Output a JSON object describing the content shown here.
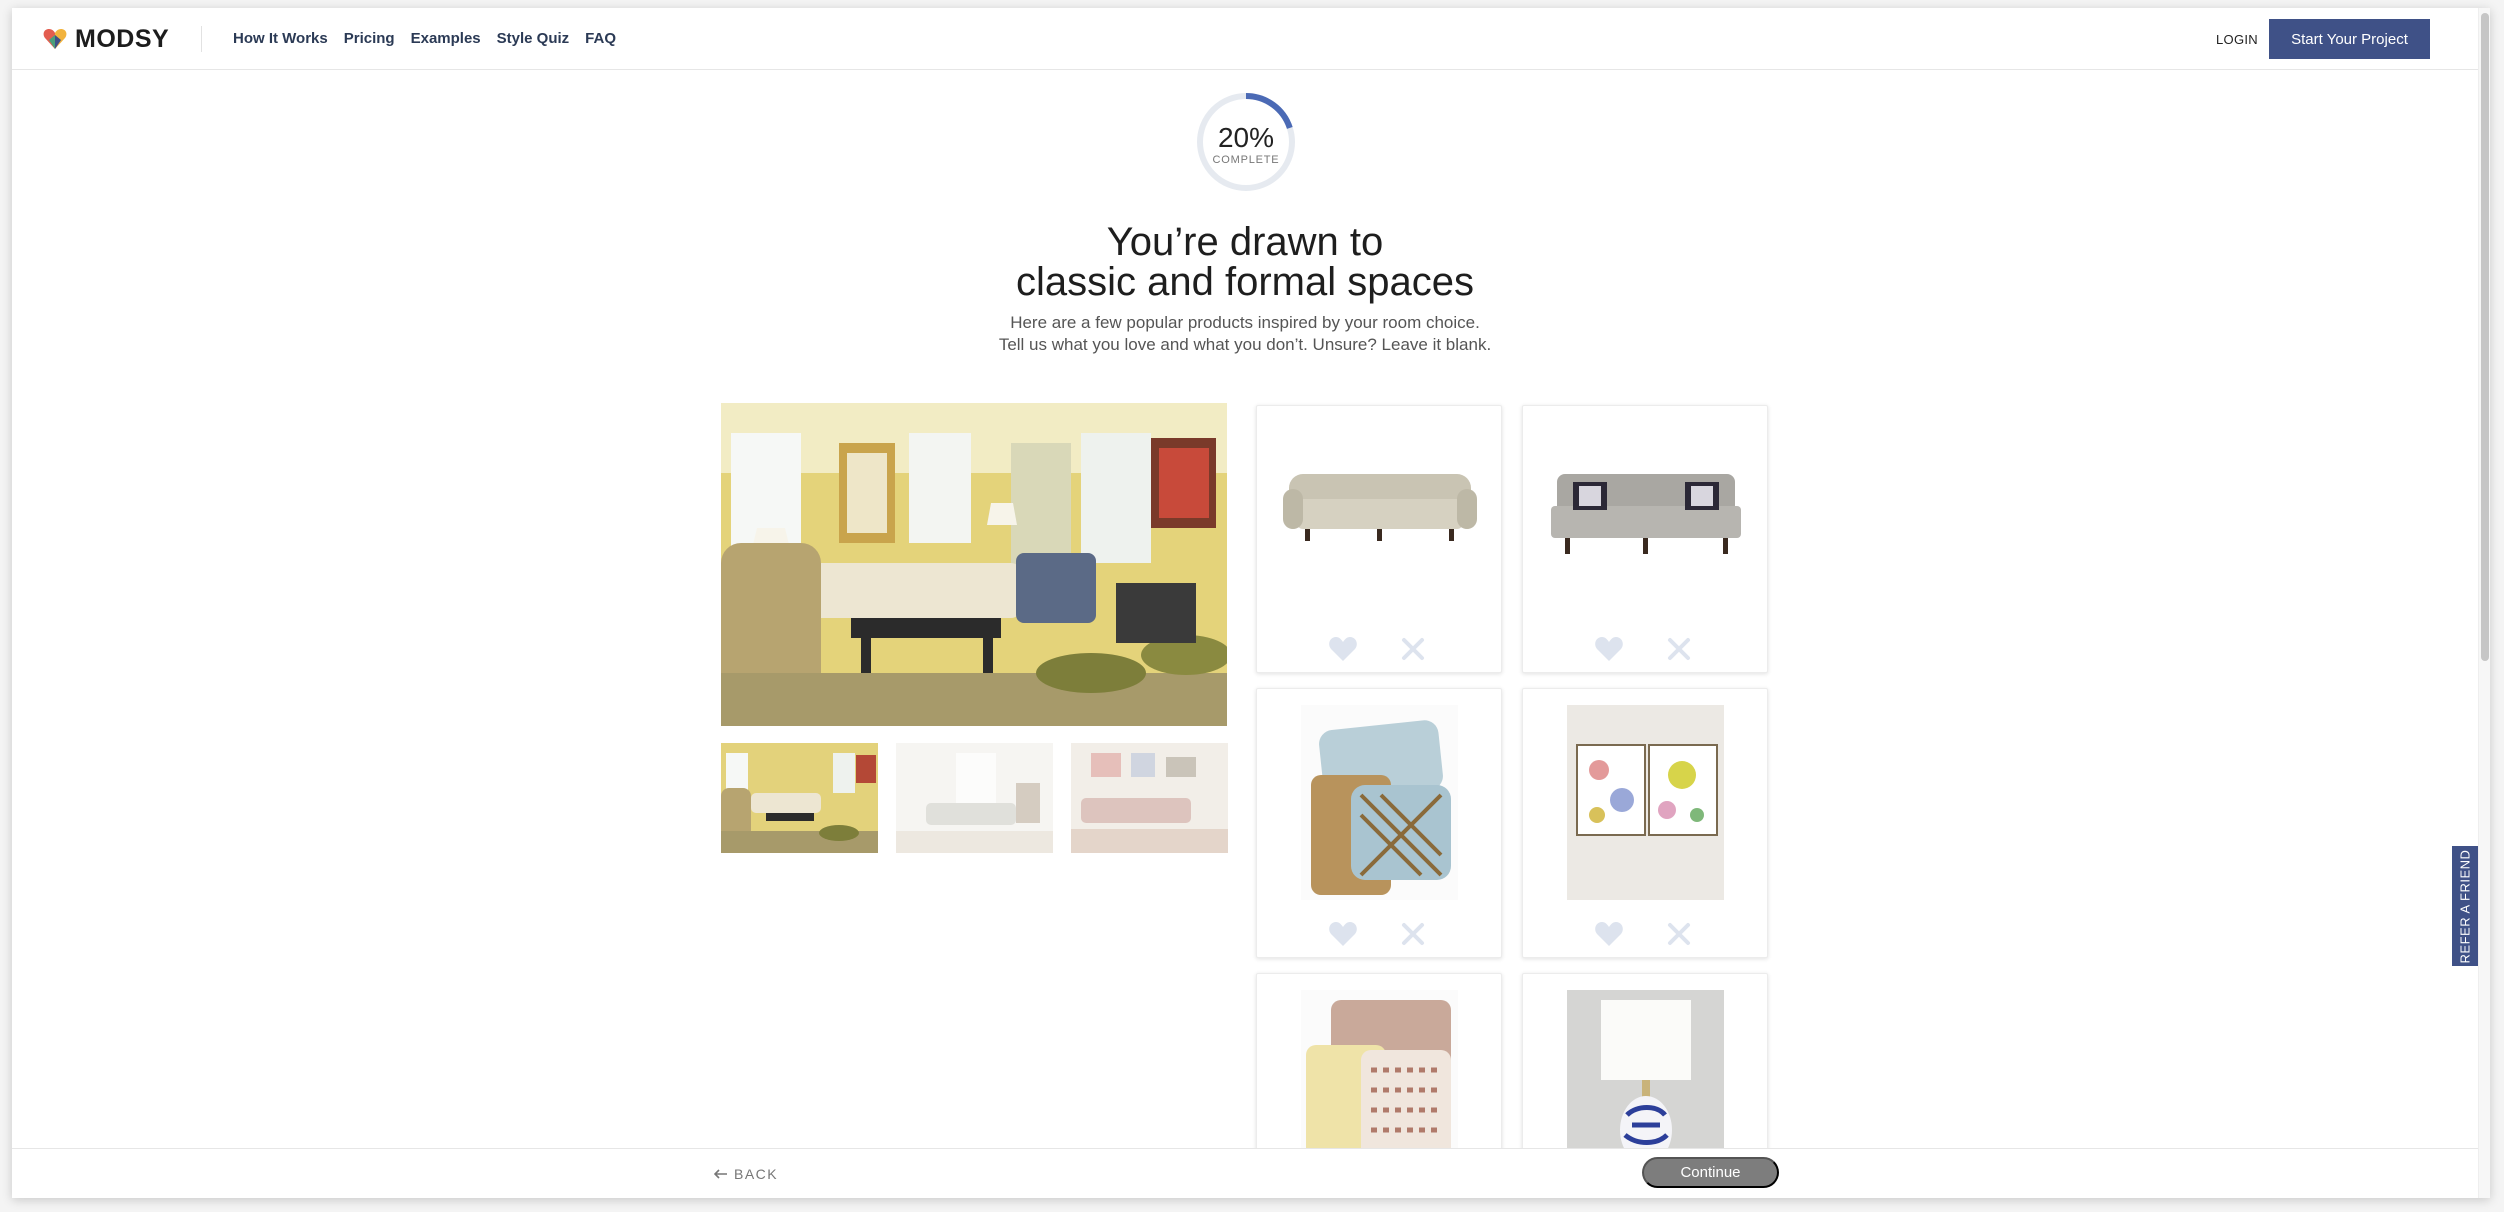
{
  "brand": {
    "name": "MODSY"
  },
  "nav": {
    "items": [
      "How It Works",
      "Pricing",
      "Examples",
      "Style Quiz",
      "FAQ"
    ]
  },
  "header": {
    "login": "LOGIN",
    "cta": "Start Your Project"
  },
  "progress": {
    "percent_text": "20%",
    "label": "COMPLETE",
    "value": 0.2
  },
  "hero": {
    "title_line1": "You’re drawn to",
    "title_line2": "classic and formal spaces",
    "sub_line1": "Here are a few popular products inspired by your room choice.",
    "sub_line2": "Tell us what you love and what you don’t. Unsure? Leave it blank."
  },
  "gallery": {
    "main_alt": "classic formal living room",
    "thumbs": [
      "living room 1",
      "living room 2",
      "living room 3"
    ]
  },
  "products": [
    {
      "name": "tufted sofa",
      "like": "heart-icon",
      "dislike": "close-icon"
    },
    {
      "name": "grey sofa",
      "like": "heart-icon",
      "dislike": "close-icon"
    },
    {
      "name": "pillows",
      "like": "heart-icon",
      "dislike": "close-icon"
    },
    {
      "name": "abstract art prints",
      "like": "heart-icon",
      "dislike": "close-icon"
    },
    {
      "name": "patterned pillows",
      "like": "heart-icon",
      "dislike": "close-icon"
    },
    {
      "name": "blue and white lamp",
      "like": "heart-icon",
      "dislike": "close-icon"
    }
  ],
  "footer": {
    "back": "BACK",
    "continue": "Continue"
  },
  "refer": {
    "label": "REFER A FRIEND"
  },
  "colors": {
    "accent": "#3f5187",
    "progress": "#4b6ab5",
    "icon": "#dde3ee"
  }
}
